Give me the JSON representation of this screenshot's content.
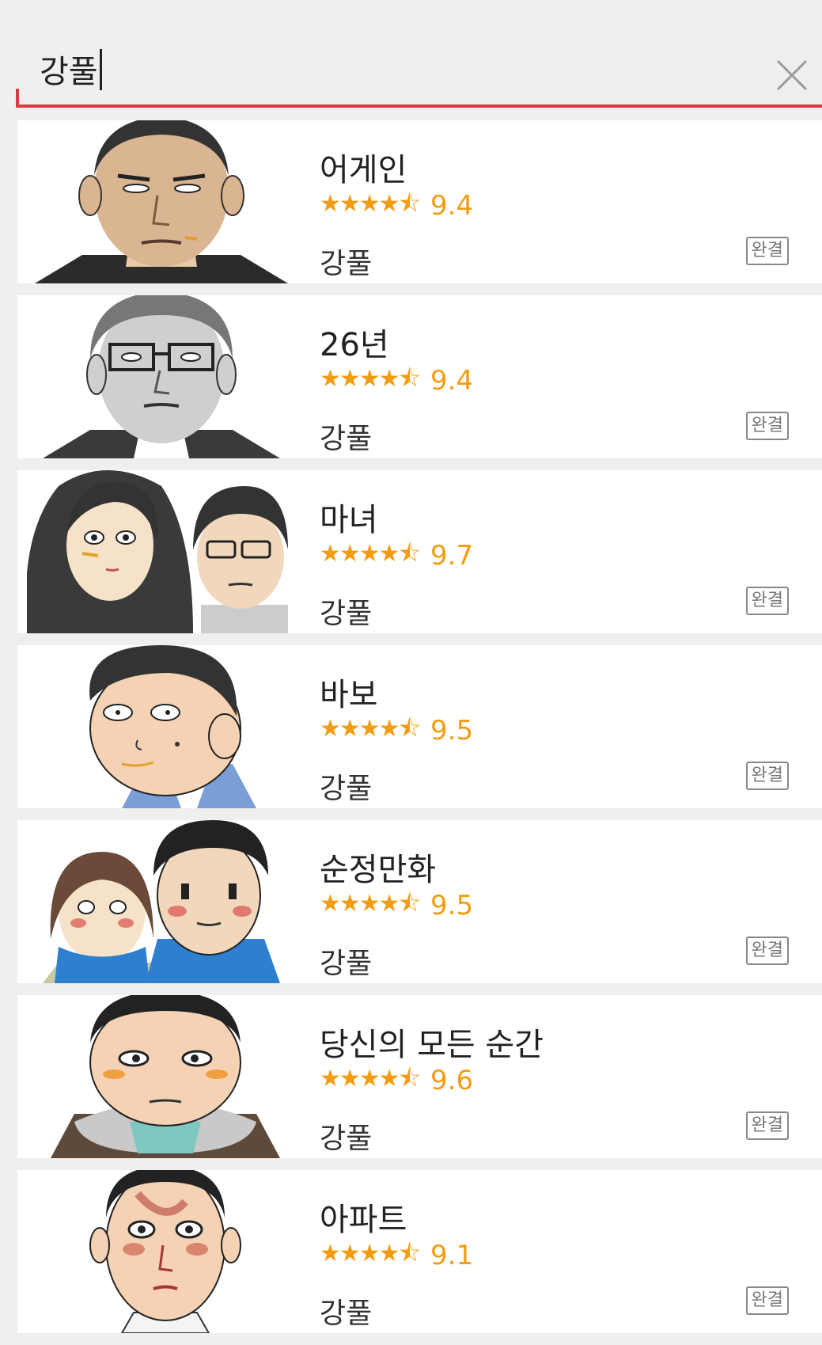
{
  "search": {
    "query": "강풀"
  },
  "results": [
    {
      "title": "어게인",
      "stars": "★★★★⯪",
      "score": "9.4",
      "author": "강풀",
      "status": "완결"
    },
    {
      "title": "26년",
      "stars": "★★★★⯪",
      "score": "9.4",
      "author": "강풀",
      "status": "완결"
    },
    {
      "title": "마녀",
      "stars": "★★★★⯪",
      "score": "9.7",
      "author": "강풀",
      "status": "완결"
    },
    {
      "title": "바보",
      "stars": "★★★★⯪",
      "score": "9.5",
      "author": "강풀",
      "status": "완결"
    },
    {
      "title": "순정만화",
      "stars": "★★★★⯪",
      "score": "9.5",
      "author": "강풀",
      "status": "완결"
    },
    {
      "title": "당신의 모든 순간",
      "stars": "★★★★⯪",
      "score": "9.6",
      "author": "강풀",
      "status": "완결"
    },
    {
      "title": "아파트",
      "stars": "★★★★⯪",
      "score": "9.1",
      "author": "강풀",
      "status": "완결"
    }
  ],
  "colors": {
    "accent": "#d93a3f",
    "rating": "#f39c12",
    "background": "#efefef"
  },
  "icons": {
    "clear": "close-icon",
    "thumbnail": "comic-character-thumbnail"
  }
}
